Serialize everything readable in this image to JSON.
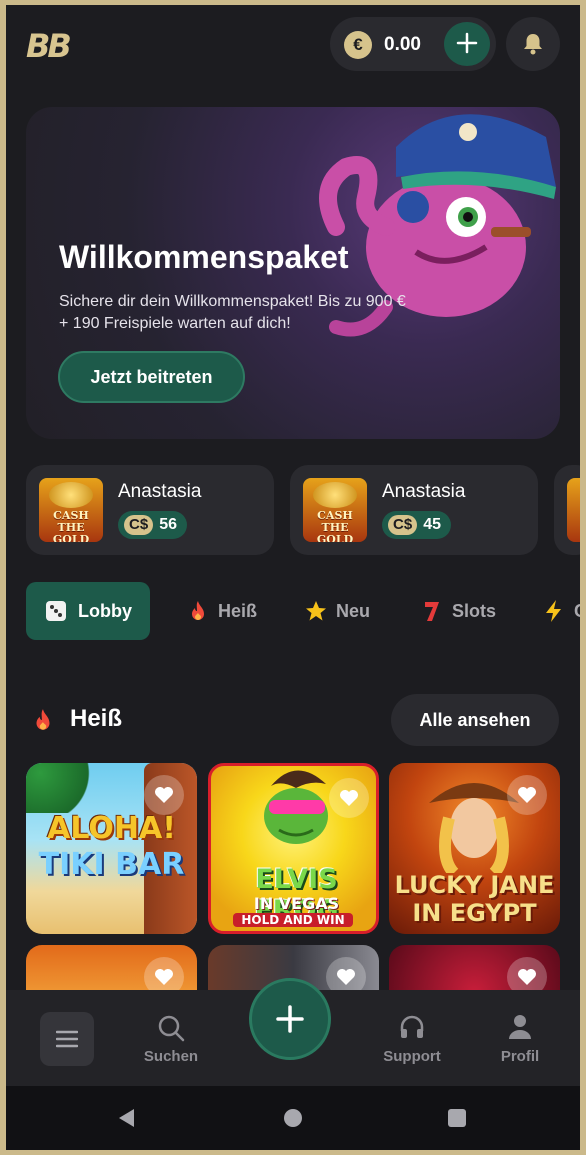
{
  "header": {
    "logo": "BB",
    "currency_symbol": "€",
    "balance": "0.00"
  },
  "hero": {
    "title": "Willkommenspaket",
    "subtitle": "Sichere dir dein Willkommenspaket! Bis zu 900 € + 190 Freispiele warten auf dich!",
    "button": "Jetzt beitreten"
  },
  "winners": [
    {
      "name": "Anastasia",
      "currency": "C$",
      "amount": "56",
      "game_label": "CASH THE GOLD"
    },
    {
      "name": "Anastasia",
      "currency": "C$",
      "amount": "45",
      "game_label": "CASH THE GOLD"
    }
  ],
  "tabs": [
    {
      "label": "Lobby",
      "icon": "dice-icon"
    },
    {
      "label": "Heiß",
      "icon": "fire-icon"
    },
    {
      "label": "Neu",
      "icon": "star-icon"
    },
    {
      "label": "Slots",
      "icon": "seven-icon"
    },
    {
      "label": "C",
      "icon": "lightning-icon"
    }
  ],
  "section": {
    "title": "Heiß",
    "see_all": "Alle ansehen"
  },
  "games": [
    {
      "line1": "ALOHA!",
      "line2": "TIKI BAR"
    },
    {
      "line1": "ELVIS FROG",
      "line2": "IN VEGAS",
      "line3": "HOLD AND WIN"
    },
    {
      "line1": "LUCKY JANE",
      "line2": "IN EGYPT"
    }
  ],
  "bottom_nav": {
    "search": "Suchen",
    "support": "Support",
    "profile": "Profil"
  },
  "colors": {
    "accent": "#1d5a4a",
    "gold": "#d6c38c",
    "background": "#1c1c20",
    "card": "#2a2a2f"
  }
}
